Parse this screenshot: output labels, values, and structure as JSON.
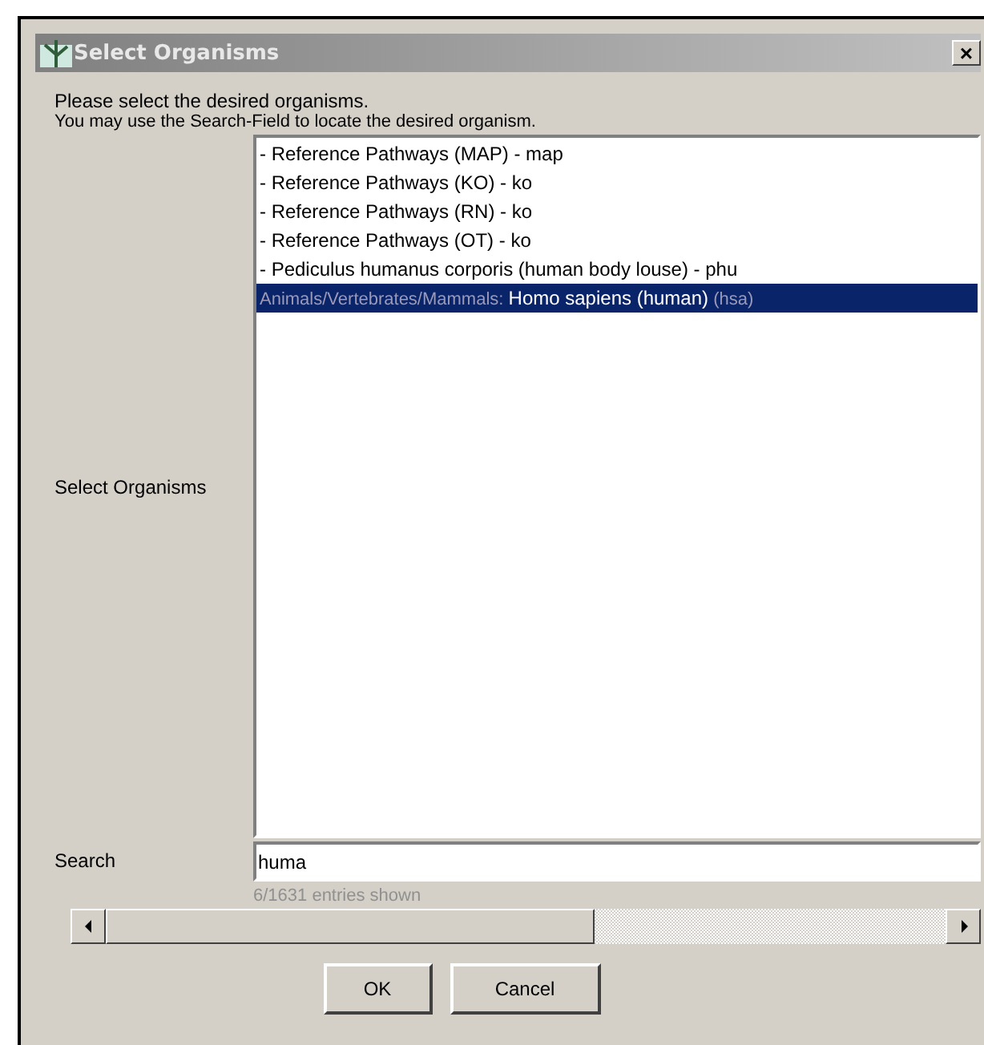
{
  "window": {
    "title": "Select Organisms",
    "close": "×"
  },
  "instructions": [
    "Please select the desired organisms.",
    "You may use the Search-Field to locate the desired organism."
  ],
  "organisms": {
    "label": "Select Organisms",
    "items": [
      {
        "label": "- Reference Pathways (MAP) - map",
        "selected": false
      },
      {
        "label": "- Reference Pathways (KO) - ko",
        "selected": false
      },
      {
        "label": "- Reference Pathways (RN) - ko",
        "selected": false
      },
      {
        "label": "- Reference Pathways (OT) - ko",
        "selected": false
      },
      {
        "label": "- Pediculus humanus corporis (human body louse) - phu",
        "selected": false
      },
      {
        "path": "Animals/Vertebrates/Mammals:",
        "label": "Homo sapiens (human)",
        "code": "(hsa)",
        "selected": true
      }
    ]
  },
  "search": {
    "label": "Search",
    "value": "huma",
    "status": "6/1631 entries shown"
  },
  "buttons": [
    "OK",
    "Cancel"
  ]
}
